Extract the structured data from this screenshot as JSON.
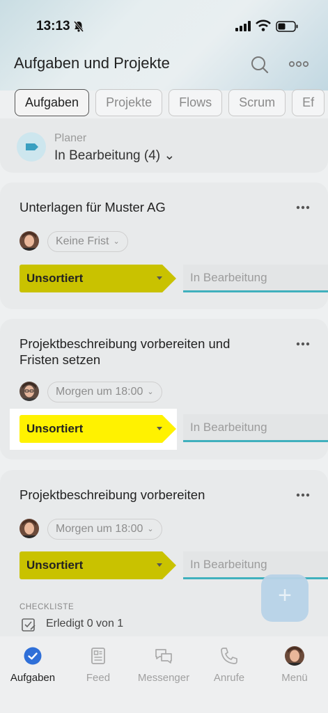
{
  "status_bar": {
    "time": "13:13"
  },
  "header": {
    "title": "Aufgaben und Projekte"
  },
  "filter_chips": [
    "Aufgaben",
    "Projekte",
    "Flows",
    "Scrum",
    "Ef"
  ],
  "planer": {
    "label": "Planer",
    "value": "In Bearbeitung (4) ⌄"
  },
  "tasks": [
    {
      "title": "Unterlagen für Muster AG",
      "deadline": "Keine Frist",
      "stage": "Unsortiert",
      "next_stage": "In Bearbeitung"
    },
    {
      "title": "Projektbeschreibung vorbereiten und Fristen setzen",
      "deadline": "Morgen um 18:00",
      "stage": "Unsortiert",
      "next_stage": "In Bearbeitung"
    },
    {
      "title": "Projektbeschreibung vorbereiten",
      "deadline": "Morgen um 18:00",
      "stage": "Unsortiert",
      "next_stage": "In Bearbeitung",
      "checklist": {
        "heading": "CHECKLISTE",
        "text": "Erledigt 0 von 1"
      }
    }
  ],
  "fab": {
    "label": "+"
  },
  "tabbar": [
    {
      "label": "Aufgaben",
      "icon": "check-circle-icon"
    },
    {
      "label": "Feed",
      "icon": "feed-icon"
    },
    {
      "label": "Messenger",
      "icon": "chat-icon"
    },
    {
      "label": "Anrufe",
      "icon": "phone-icon"
    },
    {
      "label": "Menü",
      "icon": "avatar-icon"
    }
  ],
  "colors": {
    "stage_yellow": "#c9c200",
    "stage_highlight": "#fff200",
    "accent_blue": "#2f6fd8",
    "progress_teal": "#3fb0bd"
  }
}
